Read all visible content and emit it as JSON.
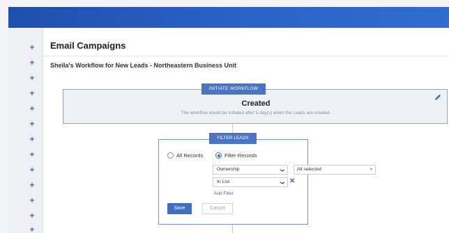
{
  "page": {
    "title": "Email Campaigns",
    "workflow_title": "Sheila's Workflow for New Leads  - Northeastern Business Unit"
  },
  "sidebar": {
    "items": [
      "+",
      "+",
      "+",
      "+",
      "+",
      "+",
      "+",
      "+",
      "+",
      "+",
      "+",
      "+",
      "+",
      "+"
    ]
  },
  "initiate": {
    "label": "INITIATE WORKFLOW",
    "status": "Created",
    "description": "The workflow would be initiated after 5 day(s) when the Leads are created."
  },
  "filter": {
    "label": "FILTER LEADS",
    "all_records": "All Records",
    "filter_records": "Filter Records",
    "field_select": "Ownership",
    "value_select": "All selected",
    "operator_select": "In List",
    "add_filter": "Add Filter",
    "save": "Save",
    "cancel": "Cancel"
  },
  "icons": {
    "expand": "plus-icon",
    "edit": "pencil-icon",
    "dropdown": "chevron-down-icon",
    "remove": "close-icon"
  },
  "colors": {
    "header": "#2a63c6",
    "accent": "#3b6fc9",
    "label_bg": "#4a75c4"
  }
}
